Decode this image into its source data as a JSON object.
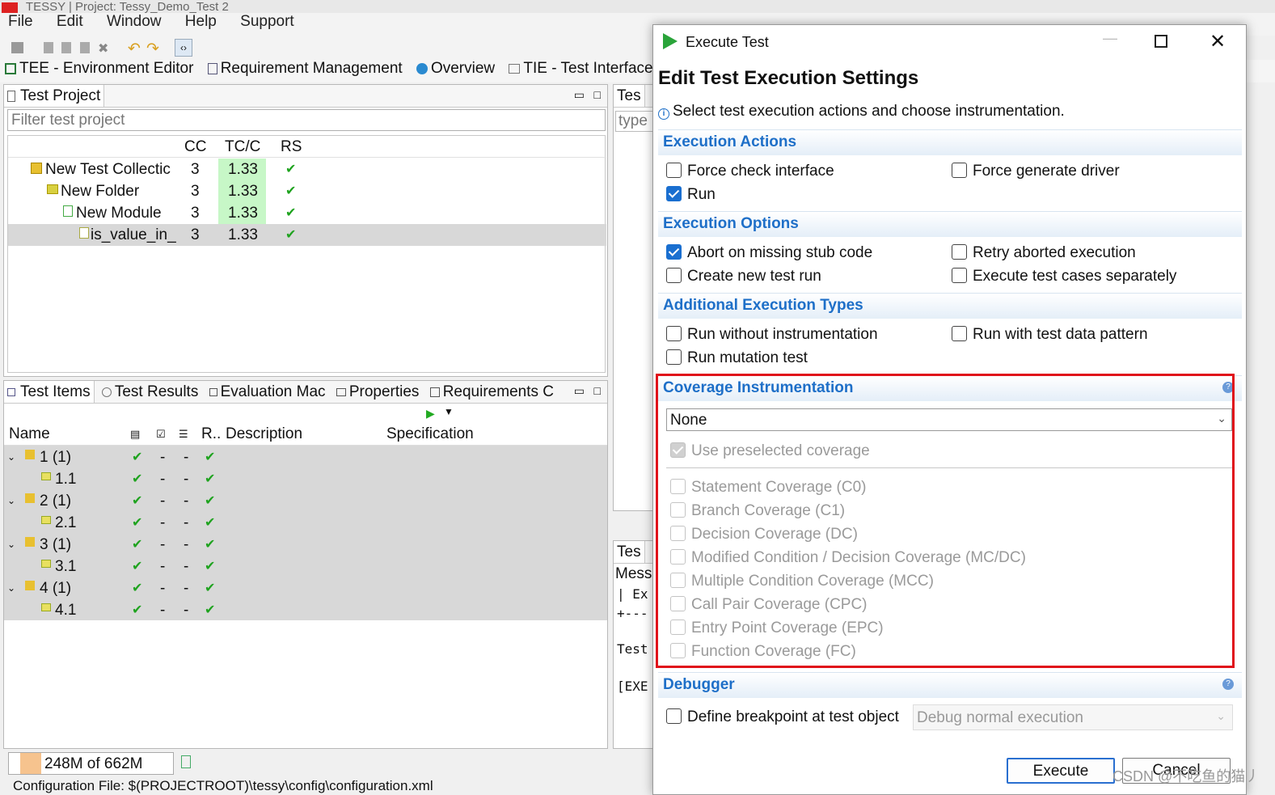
{
  "app": {
    "title": "TESSY | Project: Tessy_Demo_Test 2",
    "menu": [
      "File",
      "Edit",
      "Window",
      "Help",
      "Support"
    ]
  },
  "perspectives": [
    "TEE - Environment Editor",
    "Requirement Management",
    "Overview",
    "TIE - Test Interface E"
  ],
  "test_project": {
    "title": "Test Project",
    "filter_placeholder": "Filter test project",
    "columns": [
      "CC",
      "TC/C",
      "RS"
    ],
    "rows": [
      {
        "name": "New Test Collectic",
        "cc": "3",
        "tcc": "1.33"
      },
      {
        "name": "New Folder",
        "cc": "3",
        "tcc": "1.33"
      },
      {
        "name": "New Module",
        "cc": "3",
        "tcc": "1.33"
      },
      {
        "name": "is_value_in_",
        "cc": "3",
        "tcc": "1.33"
      }
    ]
  },
  "bottom_tabs": [
    "Test Items",
    "Test Results",
    "Evaluation Mac",
    "Properties",
    "Requirements C"
  ],
  "test_items": {
    "columns": [
      "Name",
      "R..",
      "Description",
      "Specification"
    ],
    "rows": [
      {
        "name": "1 (1)",
        "dash1": "-",
        "dash2": "-"
      },
      {
        "name": "1.1",
        "dash1": "-",
        "dash2": "-"
      },
      {
        "name": "2 (1)",
        "dash1": "-",
        "dash2": "-"
      },
      {
        "name": "2.1",
        "dash1": "-",
        "dash2": "-"
      },
      {
        "name": "3 (1)",
        "dash1": "-",
        "dash2": "-"
      },
      {
        "name": "3.1",
        "dash1": "-",
        "dash2": "-"
      },
      {
        "name": "4 (1)",
        "dash1": "-",
        "dash2": "-"
      },
      {
        "name": "4.1",
        "dash1": "-",
        "dash2": "-"
      }
    ]
  },
  "right_panel": {
    "tab1": "Tes",
    "type_placeholder": "type",
    "tab2": "Tes",
    "messages_label": "Messa",
    "console_lines": [
      "| Ex",
      "+---",
      "Test",
      "[EXE"
    ]
  },
  "status": {
    "memory": "248M of 662M",
    "config_file": "Configuration File: $(PROJECTROOT)\\tessy\\config\\configuration.xml"
  },
  "dialog": {
    "window_title": "Execute Test",
    "heading": "Edit Test Execution Settings",
    "info": "Select test execution actions and choose instrumentation.",
    "execution_actions": {
      "title": "Execution Actions",
      "force_check_interface": "Force check interface",
      "force_generate_driver": "Force generate driver",
      "run": "Run"
    },
    "execution_options": {
      "title": "Execution Options",
      "abort_missing_stub": "Abort on missing stub code",
      "retry_aborted": "Retry aborted execution",
      "create_new_run": "Create new test run",
      "execute_separately": "Execute test cases separately"
    },
    "additional_types": {
      "title": "Additional Execution Types",
      "without_instrumentation": "Run without instrumentation",
      "test_data_pattern": "Run with test data pattern",
      "mutation_test": "Run mutation test"
    },
    "coverage": {
      "title": "Coverage Instrumentation",
      "selected": "None",
      "use_preselected": "Use preselected coverage",
      "items": [
        "Statement Coverage (C0)",
        "Branch Coverage (C1)",
        "Decision Coverage (DC)",
        "Modified Condition / Decision Coverage (MC/DC)",
        "Multiple Condition Coverage (MCC)",
        "Call Pair Coverage (CPC)",
        "Entry Point Coverage (EPC)",
        "Function Coverage (FC)"
      ],
      "highlight_color": "#e0101a"
    },
    "debugger": {
      "title": "Debugger",
      "define_breakpoint": "Define breakpoint at test object",
      "mode": "Debug normal execution"
    },
    "buttons": {
      "execute": "Execute",
      "cancel": "Cancel"
    }
  },
  "watermark": "CSDN @不吃鱼的猫丿"
}
